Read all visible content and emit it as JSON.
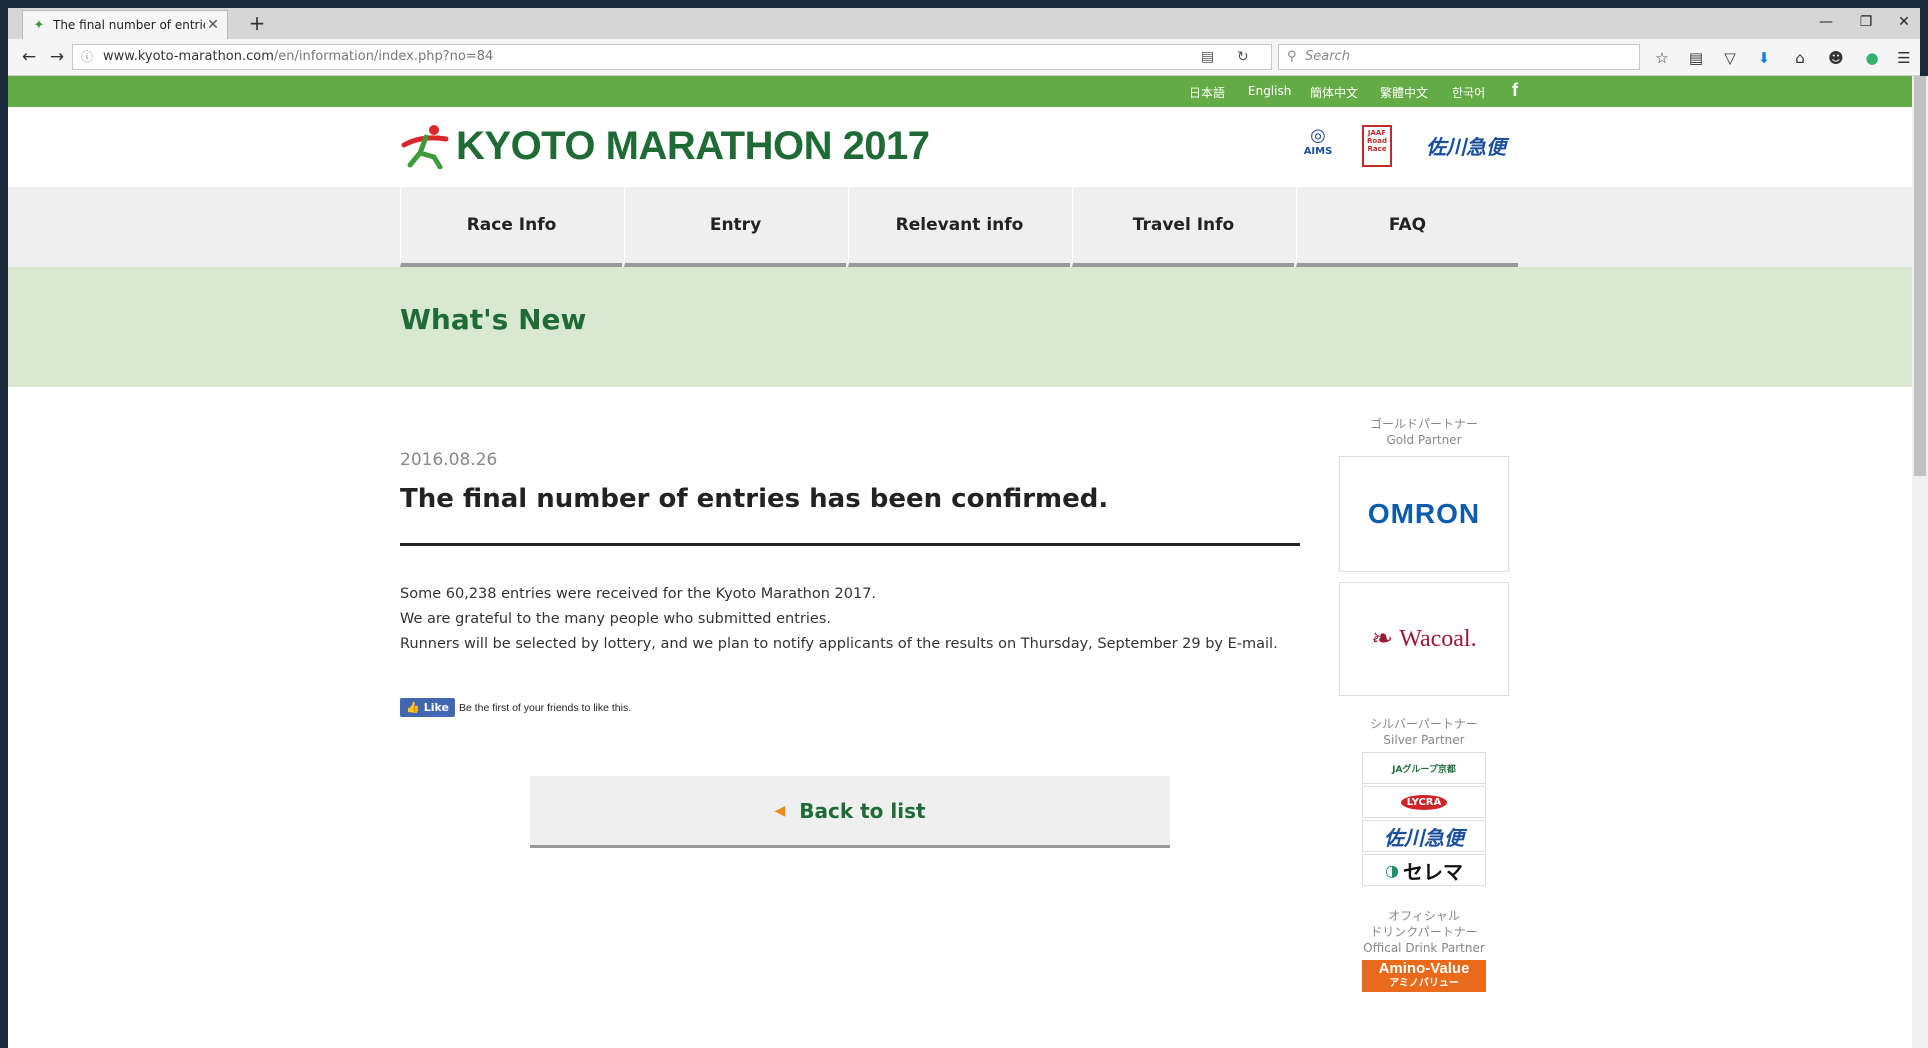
{
  "browser": {
    "tab_title": "The final number of entrie...",
    "url_domain": "www.kyoto-marathon.com",
    "url_path": "/en/information/index.php?no=84",
    "search_placeholder": "Search"
  },
  "topbar": {
    "languages": [
      "日本語",
      "English",
      "簡体中文",
      "繁體中文",
      "한국어"
    ],
    "facebook_icon": "f"
  },
  "header": {
    "logo_text": "KYOTO MARATHON 2017",
    "sponsors": [
      "AIMS",
      "JAAF Road Race",
      "佐川急便"
    ]
  },
  "nav": {
    "items": [
      "Race Info",
      "Entry",
      "Relevant info",
      "Travel Info",
      "FAQ"
    ]
  },
  "section": {
    "title": "What's New"
  },
  "article": {
    "date": "2016.08.26",
    "title": "The final number of entries has been confirmed.",
    "lines": [
      "Some 60,238 entries were received for the Kyoto Marathon 2017.",
      "We are grateful to the many people who submitted entries.",
      "Runners will be selected by lottery, and we plan to notify applicants of the results on Thursday, September 29 by E-mail."
    ]
  },
  "facebook": {
    "like_label": "Like",
    "like_text": "Be the first of your friends to like this."
  },
  "back_button": {
    "label": "Back to list"
  },
  "sidebar": {
    "gold_jp": "ゴールドパートナー",
    "gold_en": "Gold Partner",
    "gold_partners": [
      "OMRON",
      "Wacoal."
    ],
    "silver_jp": "シルバーパートナー",
    "silver_en": "Silver Partner",
    "silver_partners": [
      "JAグループ京都",
      "LYCRA",
      "佐川急便",
      "セレマ"
    ],
    "drink_jp1": "オフィシャル",
    "drink_jp2": "ドリンクパートナー",
    "drink_en": "Offical Drink Partner",
    "drink_partner": "Amino-Value",
    "drink_partner_jp": "アミノバリュー"
  },
  "colors": {
    "green_strip": "#62ab45",
    "brand_green": "#1e6b35",
    "light_green": "#d8e8d2",
    "nav_gray": "#efefef",
    "orange_arrow": "#e98a1a"
  }
}
